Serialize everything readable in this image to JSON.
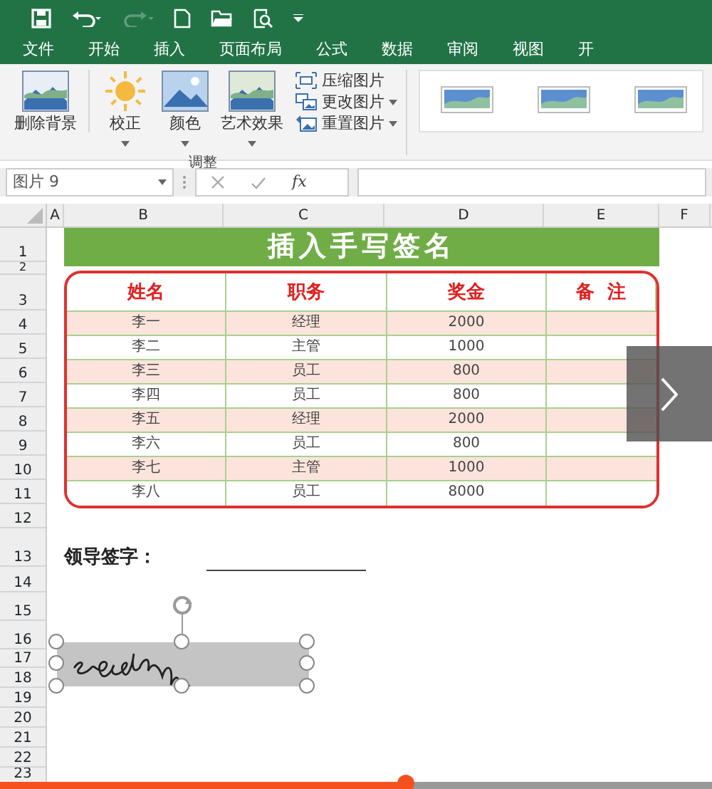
{
  "quick_access": [
    {
      "kind": "save",
      "disabled": false
    },
    {
      "kind": "undo",
      "disabled": false
    },
    {
      "kind": "redo",
      "disabled": true
    },
    {
      "kind": "new",
      "disabled": false
    },
    {
      "kind": "open",
      "disabled": false
    },
    {
      "kind": "preview",
      "disabled": false
    },
    {
      "kind": "customize",
      "disabled": false
    }
  ],
  "tabs": [
    "文件",
    "开始",
    "插入",
    "页面布局",
    "公式",
    "数据",
    "审阅",
    "视图",
    "开"
  ],
  "ribbon": {
    "group_label": "调整",
    "large_buttons": [
      {
        "kind": "remove-background",
        "label": "删除背景",
        "dropdown": false
      },
      {
        "kind": "corrections",
        "label": "校正",
        "dropdown": true
      },
      {
        "kind": "color",
        "label": "颜色",
        "dropdown": true
      },
      {
        "kind": "artistic",
        "label": "艺术效果",
        "dropdown": true
      }
    ],
    "small_buttons": [
      {
        "kind": "compress",
        "label": "压缩图片",
        "dropdown": false
      },
      {
        "kind": "change",
        "label": "更改图片",
        "dropdown": true
      },
      {
        "kind": "reset",
        "label": "重置图片",
        "dropdown": true
      }
    ]
  },
  "formula_bar": {
    "name_box": "图片 9",
    "fx": "fx"
  },
  "columns": [
    "A",
    "B",
    "C",
    "D",
    "E",
    "F"
  ],
  "row_numbers": [
    "1",
    "2",
    "3",
    "4",
    "5",
    "6",
    "7",
    "8",
    "9",
    "10",
    "11",
    "12",
    "13",
    "14",
    "15",
    "16",
    "17",
    "18",
    "19",
    "20",
    "21",
    "22",
    "23"
  ],
  "sheet": {
    "title": "插入手写签名",
    "headers": [
      "姓名",
      "职务",
      "奖金",
      "备  注"
    ],
    "rows": [
      {
        "name": "李一",
        "position": "经理",
        "bonus": "2000",
        "shaded": true
      },
      {
        "name": "李二",
        "position": "主管",
        "bonus": "1000",
        "shaded": false
      },
      {
        "name": "李三",
        "position": "员工",
        "bonus": "800",
        "shaded": true
      },
      {
        "name": "李四",
        "position": "员工",
        "bonus": "800",
        "shaded": false
      },
      {
        "name": "李五",
        "position": "经理",
        "bonus": "2000",
        "shaded": true
      },
      {
        "name": "李六",
        "position": "员工",
        "bonus": "800",
        "shaded": false
      },
      {
        "name": "李七",
        "position": "主管",
        "bonus": "1000",
        "shaded": true
      },
      {
        "name": "李八",
        "position": "员工",
        "bonus": "8000",
        "shaded": false
      }
    ],
    "signature_label": "领导签字："
  },
  "video": {
    "level": 0.57
  }
}
